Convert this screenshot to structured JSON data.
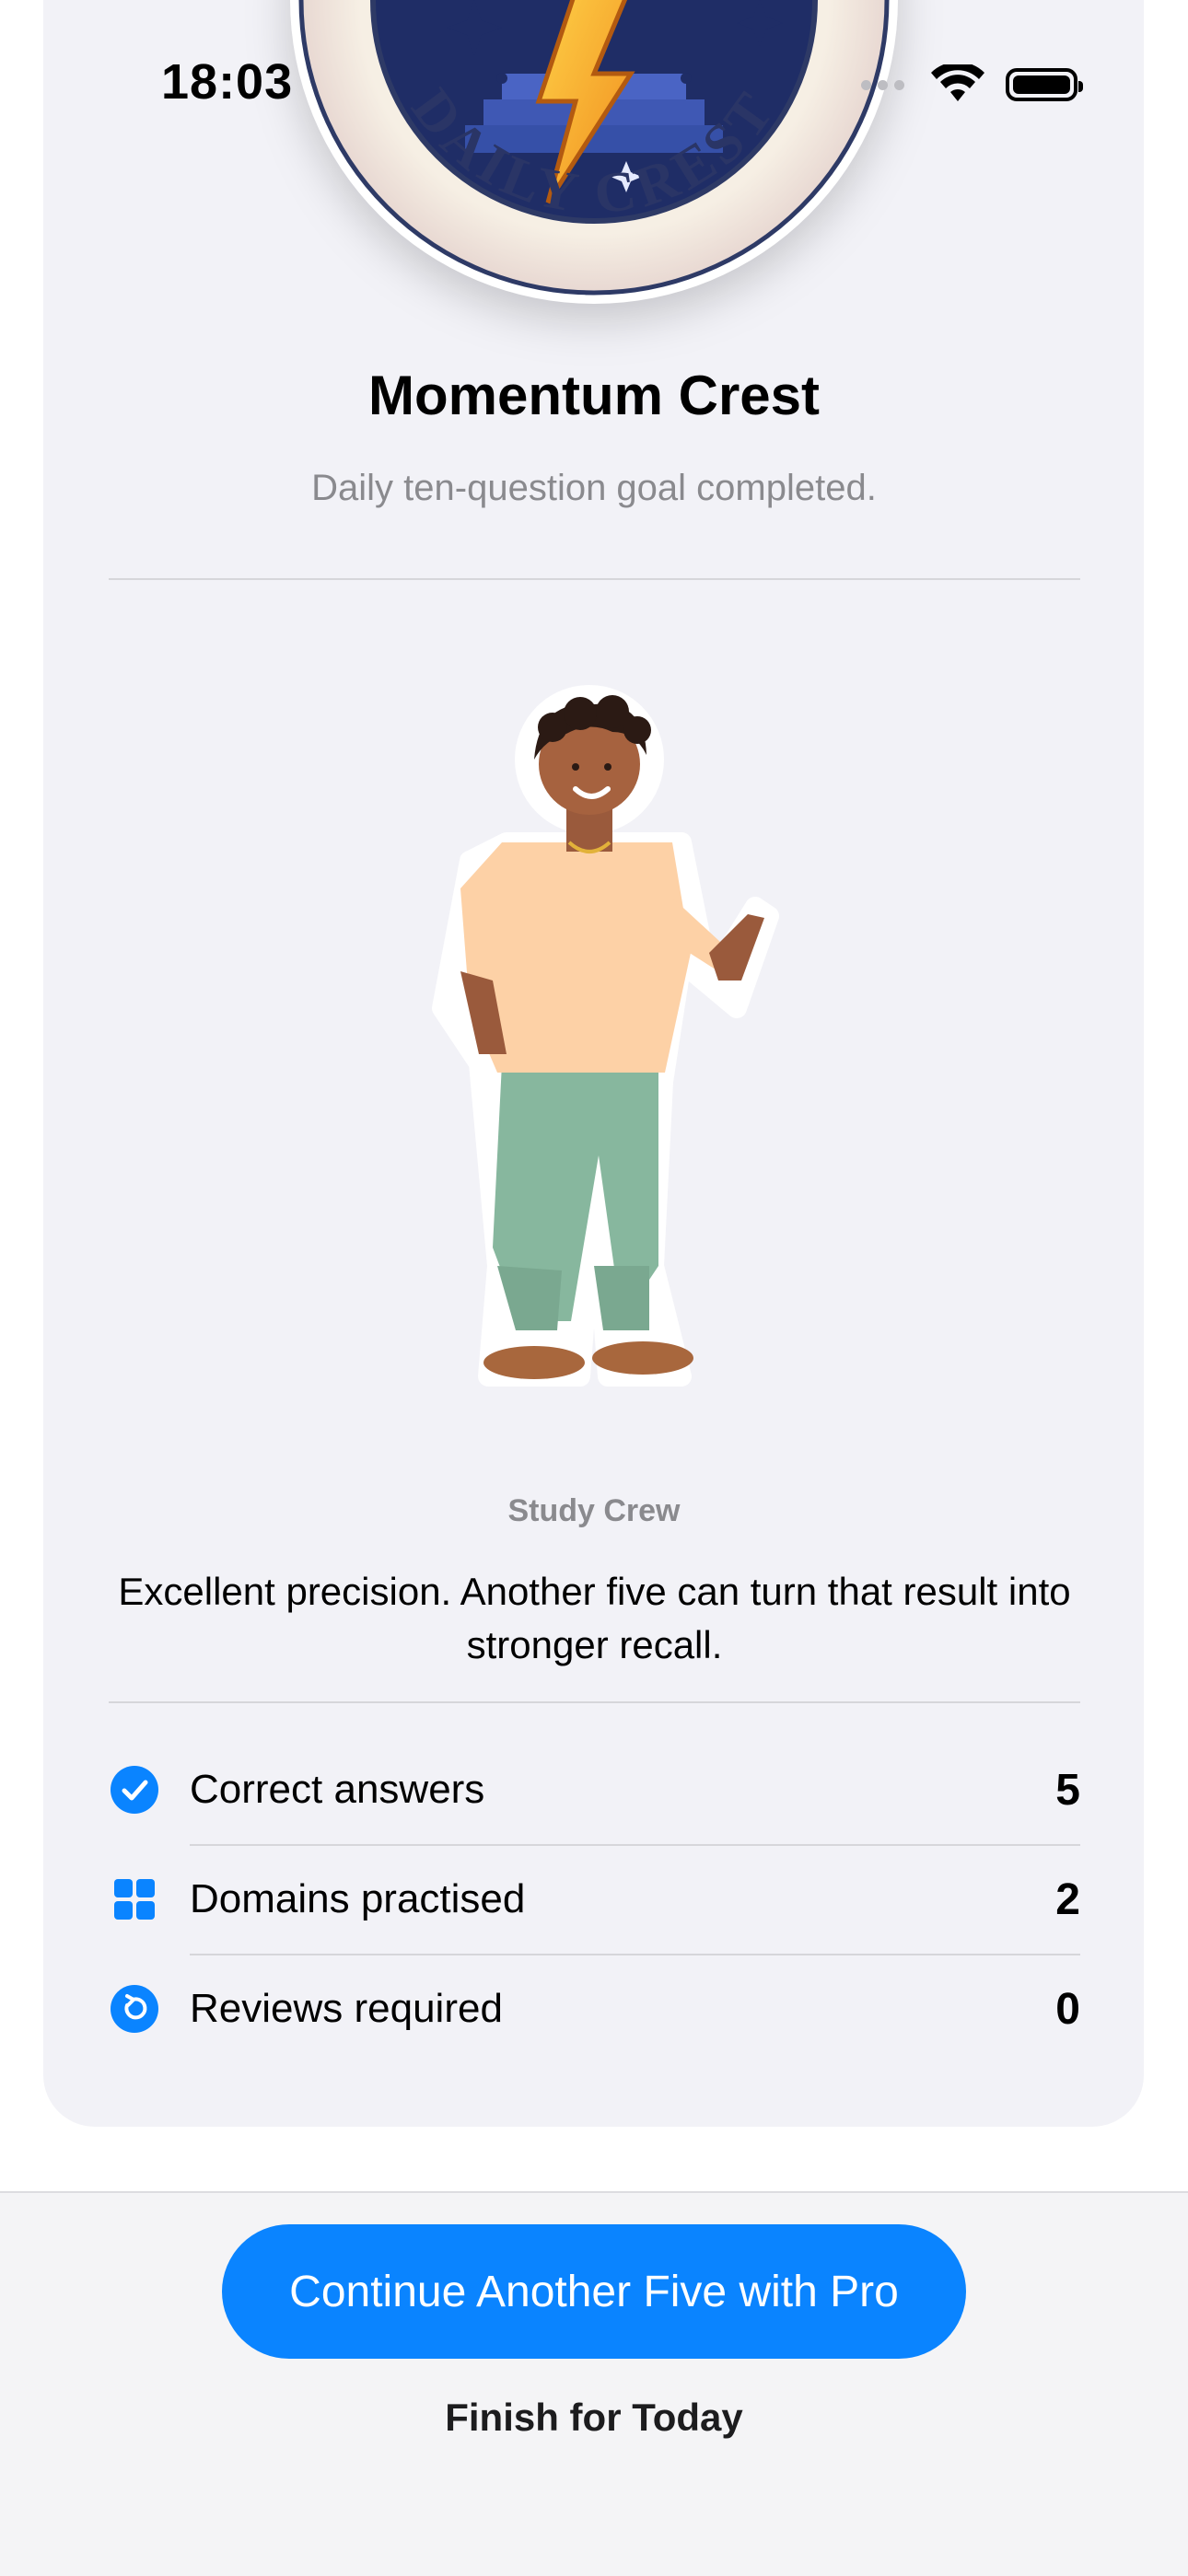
{
  "status_bar": {
    "time": "18:03"
  },
  "badge": {
    "emblem_text": "DAILY CREST",
    "title": "Momentum Crest",
    "subtitle": "Daily ten-question goal completed."
  },
  "mascot": {
    "crew_label": "Study Crew",
    "message": "Excellent precision. Another five can turn that result into stronger recall."
  },
  "stats": [
    {
      "icon": "checkmark-circle-icon",
      "label": "Correct answers",
      "value": "5"
    },
    {
      "icon": "grid-icon",
      "label": "Domains practised",
      "value": "2"
    },
    {
      "icon": "refresh-circle-icon",
      "label": "Reviews required",
      "value": "0"
    }
  ],
  "actions": {
    "primary_label": "Continue Another Five with Pro",
    "secondary_label": "Finish for Today"
  },
  "colors": {
    "accent": "#0A84FF",
    "card_bg": "#F2F2F7",
    "secondary_text": "#8A8A8E"
  }
}
